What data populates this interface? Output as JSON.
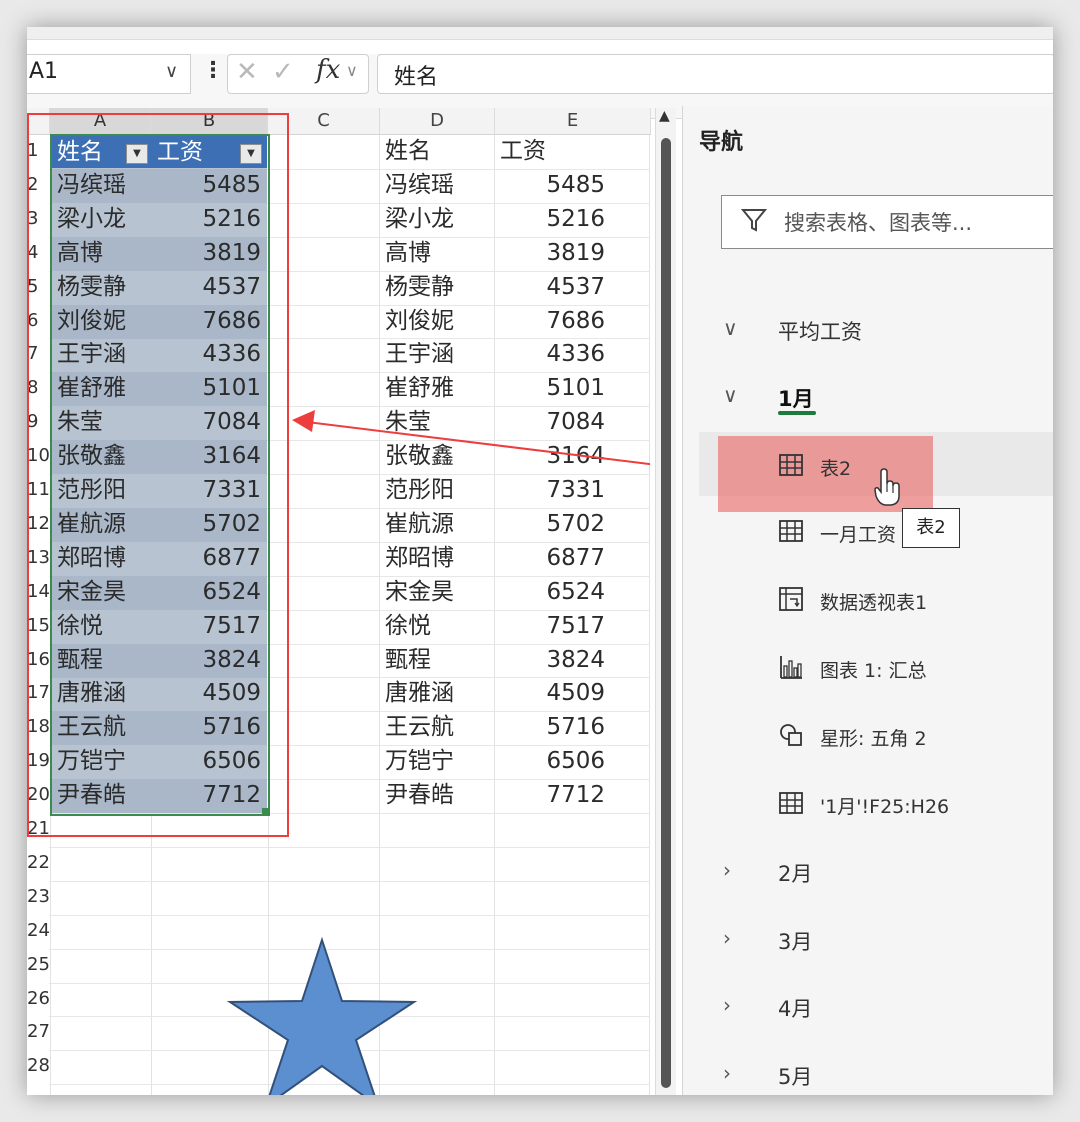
{
  "formula_bar": {
    "name_box": "A1",
    "fx_label": "fx",
    "formula_value": "姓名"
  },
  "grid": {
    "columns": [
      "A",
      "B",
      "C",
      "D",
      "E"
    ],
    "rows": [
      "1",
      "2",
      "3",
      "4",
      "5",
      "6",
      "7",
      "8",
      "9",
      "10",
      "11",
      "12",
      "13",
      "14",
      "15",
      "16",
      "17",
      "18",
      "19",
      "20",
      "21",
      "22",
      "23",
      "24",
      "25",
      "26",
      "27",
      "28"
    ],
    "table_headers": [
      "姓名",
      "工资"
    ],
    "names": [
      "冯缤瑶",
      "梁小龙",
      "高博",
      "杨雯静",
      "刘俊妮",
      "王宇涵",
      "崔舒雅",
      "朱莹",
      "张敬鑫",
      "范彤阳",
      "崔航源",
      "郑昭博",
      "宋金昊",
      "徐悦",
      "甄程",
      "唐雅涵",
      "王云航",
      "万铠宁",
      "尹春皓"
    ],
    "salaries": [
      "5485",
      "5216",
      "3819",
      "4537",
      "7686",
      "4336",
      "5101",
      "7084",
      "3164",
      "7331",
      "5702",
      "6877",
      "6524",
      "7517",
      "3824",
      "4509",
      "5716",
      "6506",
      "7712"
    ]
  },
  "nav_pane": {
    "title": "导航",
    "search_placeholder": "搜索表格、图表等...",
    "groups": [
      {
        "label": "平均工资",
        "expanded": false
      },
      {
        "label": "1月",
        "expanded": true
      },
      {
        "label": "2月"
      },
      {
        "label": "3月"
      },
      {
        "label": "4月"
      },
      {
        "label": "5月"
      }
    ],
    "items": [
      {
        "label": "表2",
        "icon": "table-icon"
      },
      {
        "label": "一月工资",
        "icon": "table-icon"
      },
      {
        "label": "数据透视表1",
        "icon": "pivot-table-icon"
      },
      {
        "label": "图表 1: 汇总",
        "icon": "chart-icon"
      },
      {
        "label": "星形: 五角 2",
        "icon": "shape-icon"
      },
      {
        "label": "'1月'!F25:H26",
        "icon": "table-icon"
      }
    ],
    "tooltip": "表2"
  },
  "colors": {
    "table_header": "#3d6fb5",
    "selection_border": "#3c8a4e",
    "annotation_red": "#ee3d3d",
    "star_fill": "#5b8fd0"
  }
}
